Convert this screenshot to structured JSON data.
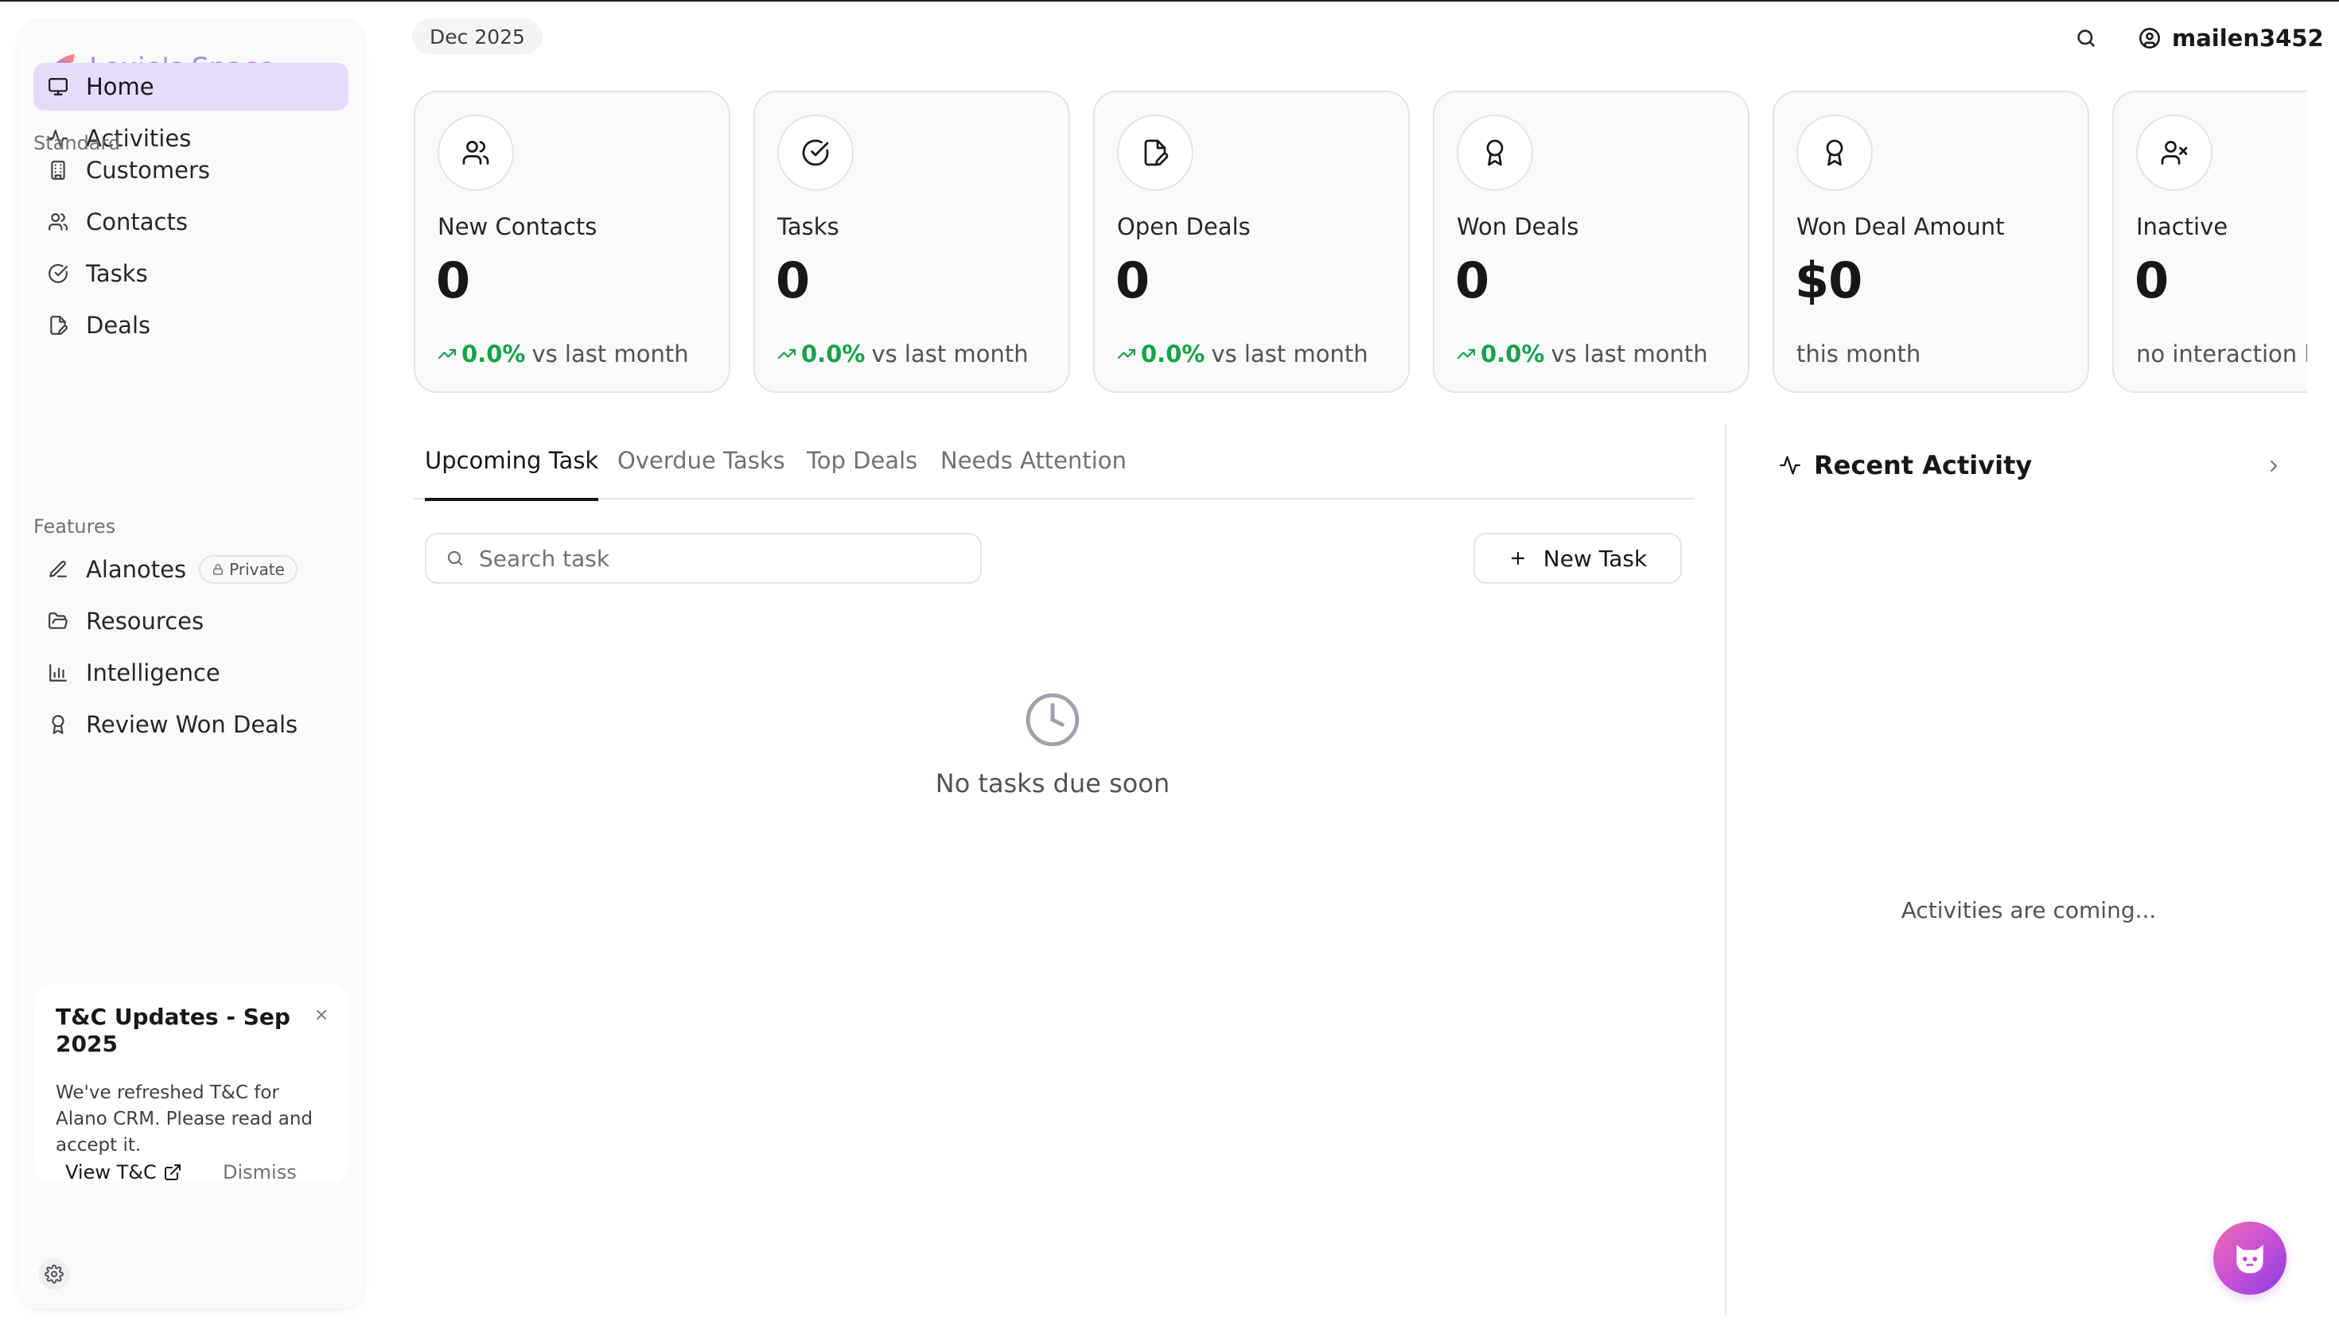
{
  "app": {
    "brand_name": "Louie's Space",
    "accent_color": "#a98ae6",
    "active_nav_bg": "#e7dbfb"
  },
  "sidebar": {
    "primary": [
      {
        "label": "Home",
        "icon": "monitor-icon",
        "active": true
      },
      {
        "label": "Activities",
        "icon": "activity-pulse-icon",
        "active": false
      }
    ],
    "standard_title": "Standard",
    "standard": [
      {
        "label": "Customers",
        "icon": "building-icon"
      },
      {
        "label": "Contacts",
        "icon": "users-icon"
      },
      {
        "label": "Tasks",
        "icon": "circle-check-icon"
      },
      {
        "label": "Deals",
        "icon": "file-edit-icon"
      }
    ],
    "features_title": "Features",
    "features": [
      {
        "label": "Alanotes",
        "icon": "pen-icon",
        "badge": "Private"
      },
      {
        "label": "Resources",
        "icon": "folder-open-icon"
      },
      {
        "label": "Intelligence",
        "icon": "bar-chart-icon"
      },
      {
        "label": "Review Won Deals",
        "icon": "award-icon"
      }
    ],
    "notice": {
      "title": "T&C Updates - Sep 2025",
      "body": "We've refreshed T&C for Alano CRM. Please read and accept it.",
      "view_label": "View T&C",
      "dismiss_label": "Dismiss"
    }
  },
  "header": {
    "date": "Dec 2025",
    "username": "mailen3452"
  },
  "stats": [
    {
      "label": "New Contacts",
      "value": "0",
      "trend": "0.0%",
      "foot": "vs last month",
      "icon": "users-icon"
    },
    {
      "label": "Tasks",
      "value": "0",
      "trend": "0.0%",
      "foot": "vs last month",
      "icon": "circle-check-icon"
    },
    {
      "label": "Open Deals",
      "value": "0",
      "trend": "0.0%",
      "foot": "vs last month",
      "icon": "file-edit-icon"
    },
    {
      "label": "Won Deals",
      "value": "0",
      "trend": "0.0%",
      "foot": "vs last month",
      "icon": "award-icon"
    },
    {
      "label": "Won Deal Amount",
      "value": "$0",
      "trend": "",
      "foot": "this month",
      "icon": "award-icon"
    },
    {
      "label": "Inactive",
      "value": "0",
      "trend": "",
      "foot": "no interaction last",
      "icon": "user-x-icon"
    }
  ],
  "trend_color": "#16a34a",
  "tasks": {
    "tabs": [
      {
        "label": "Upcoming Task",
        "active": true
      },
      {
        "label": "Overdue Tasks",
        "active": false
      },
      {
        "label": "Top Deals",
        "active": false
      },
      {
        "label": "Needs Attention",
        "active": false
      }
    ],
    "search_placeholder": "Search task",
    "new_task_label": "New Task",
    "empty_text": "No tasks due soon"
  },
  "recent_activity": {
    "title": "Recent Activity",
    "placeholder": "Activities are coming..."
  }
}
